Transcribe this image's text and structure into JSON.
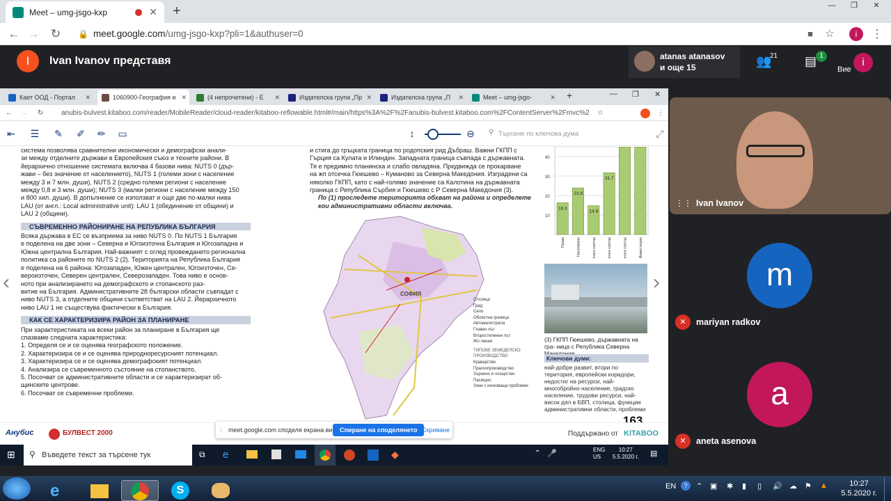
{
  "browser": {
    "tab_title": "Meet – umg-jsgo-kxp",
    "url_host": "meet.google.com",
    "url_path": "/umg-jsgo-kxp?pli=1&authuser=0",
    "profile_initial": "i"
  },
  "meet": {
    "presenter_initial": "I",
    "presenter_text": "Ivan Ivanov представя",
    "people_title": "atanas atanasov",
    "people_sub": "и още 15",
    "people_count": "21",
    "chat_badge": "1",
    "you_label": "Вие",
    "you_initial": "i"
  },
  "participants": [
    {
      "name": "Ivan Ivanov",
      "initial": "",
      "color": "#5d4037",
      "muted": false
    },
    {
      "name": "mariyan radkov",
      "initial": "m",
      "color": "#1565c0",
      "muted": true
    },
    {
      "name": "aneta asenova",
      "initial": "a",
      "color": "#c2185b",
      "muted": true
    }
  ],
  "shared": {
    "tabs": [
      {
        "label": "Кает ООД - Портал",
        "color": "#1565c0"
      },
      {
        "label": "1060900-География и",
        "color": "#6d4c41",
        "active": true
      },
      {
        "label": "(4 непрочетени) - Е",
        "color": "#2e7d32"
      },
      {
        "label": "Издателска група „Пр",
        "color": "#1a237e"
      },
      {
        "label": "Издателска група „П",
        "color": "#1a237e"
      },
      {
        "label": "Meet – umg-jsgo-",
        "color": "#00897b"
      }
    ],
    "url": "anubis-bulvest.kitaboo.com/reader/MobileReader/cloud-reader/kitaboo-reflowable.html#/main/https%3A%2F%2Fanubis-bulvest.kitaboo.com%2FContentServer%2Fmvc%2",
    "search_placeholder": "Търсене по ключова дума",
    "col1_intro": [
      "система позволява сравнителни икономически и демографски анали-",
      "зи между отделните държави в Европейския съюз и техните райони. В",
      "йерархично отношение системата включва 4 базови нива: NUTS 0 (дър-",
      "жави – без значение от населението), NUTS 1 (големи зони с население",
      "между 3 и 7 млн. души), NUTS 2 (средно големи региони с население",
      "между 0,8 и 3 млн. души); NUTS 3 (малки региони с население между 150",
      "и 800 хил. души). В допълнение се използват и още две по-малки нива",
      "LAU (от англ.: Local administrative unit): LAU 1 (обединение от общини) и",
      "LAU 2 (общини)."
    ],
    "col1_h1": "СЪВРЕМЕННО РАЙОНИРАНЕ НА РЕПУБЛИКА БЪЛГАРИЯ",
    "col1_p2": [
      "Всяка държава в ЕС се възприема за ниво NUTS 0. По NUTS 1 България",
      "е поделена на две зони – Северна и Югоизточна България и Югозападна и",
      "Южна централна България. Най-важният с оглед провеждането регионална",
      "политика са районите по NUTS 2 (2). Територията на Република България",
      "е поделена на 6 района: Югозападен, Южен централен, Югоизточен, Се-",
      "вероизточен, Северен централен, Северозападен. Това ниво е основ-",
      "ното при анализирането на демографското и стопанското раз-",
      "витие на България. Административните 28 български области съвпадат с",
      "ниво NUTS 3, а отделните общини съответстват на LAU 2. Йерархичното",
      "ниво LAU 1 не съществува фактически в България."
    ],
    "col1_h2": "КАК СЕ ХАРАКТЕРИЗИРА РАЙОН ЗА ПЛАНИРАНЕ",
    "col1_p3": [
      "При характеристиката на всеки район за планиране в България ще",
      "спазваме следната характеристика:",
      "1. Определя се и се оценява географското положение.",
      "2. Характеризира се и се оценява природноресурсният потенциал.",
      "3. Характеризира се и се оценява демографският потенциал.",
      "4. Анализира се съвременното състояние на стопанството.",
      "5. Посочват се административните области и се характеризират об-",
      "щинските центрове.",
      "6. Посочват се съвременни проблеми."
    ],
    "col2_lines": [
      "и стига до гръцката граница по родопския рид Дъбраш. Важни ГКПП с",
      "Гърция са Кулата и Илинден. Западната граница съвпада с държавната.",
      "Тя е предимно планинска и слабо овладяна. Предвижда се прокарване",
      "на жп отсечка Гюешево – Куманово за Северна Македония. Изградени са",
      "няколко ГКПП, като с най-голямо значение са Калотина на държавната",
      "граница с Република Сърбия и Гюешево с Р Северна Македония (3)."
    ],
    "col2_task": "По (1) проследете територията обхват на района и определете кои административни области включва.",
    "map_legend": [
      "Столица",
      "Град",
      "Село",
      "Областна граница",
      "Автомагистрала",
      "Главен път",
      "Второстепенен път",
      "Жп линия"
    ],
    "map_legend_h": "ТИПОВЕ ЗЕМЕДЕЛСКО ПРОИЗВОДСТВО",
    "map_legend2": [
      "Краварство",
      "Праскопроизводство",
      "Зърнено и лозарство",
      "Пасищно",
      "Зони с изчезващи проблеми"
    ],
    "map_city": "СОФИЯ",
    "map_label": "1",
    "caption": "(3) ГКПП Гюешево, държавната на гра- ница с Република Северна Македония",
    "kw_title": "Ключови думи:",
    "kw_text": "най-добре развит, втори по територия, европейски коридори, недостиг на ресурси, най-многобройно население, градско население, трудови ресурси, най-висок дял в БВП, столица, функции административни области, проблеми",
    "page_number": "163",
    "footer_brand_left": "Анубис",
    "footer_brand_mid": "БУЛВЕСТ 2000",
    "footer_powered": "Поддържано от",
    "footer_kitaboo": "KITABOO",
    "share_text": "meet.google.com споделя екрана ви.",
    "share_stop": "Спиране на споделянето",
    "share_hide": "Скриване"
  },
  "chart_data": {
    "type": "bar",
    "categories": [
      "Пазва",
      "Насилване",
      "Първичен сектор",
      "Вторичен сектор",
      "Третичен сектор",
      "Инвестиции"
    ],
    "values": [
      16.3,
      23.9,
      14.8,
      31.7,
      45,
      45
    ],
    "data_labels": [
      "16.3",
      "23.9",
      "14.8",
      "31.7",
      "",
      ""
    ],
    "ylim": [
      0,
      45
    ],
    "yticks": [
      "40",
      "30",
      "20",
      "10"
    ]
  },
  "inner_taskbar": {
    "search_placeholder": "Въведете текст за търсене тук",
    "lang": "ENG",
    "region": "US",
    "time": "10:27",
    "date": "5.5.2020 г."
  },
  "outer_taskbar": {
    "lang": "EN",
    "time": "10:27",
    "date": "5.5.2020 г."
  }
}
